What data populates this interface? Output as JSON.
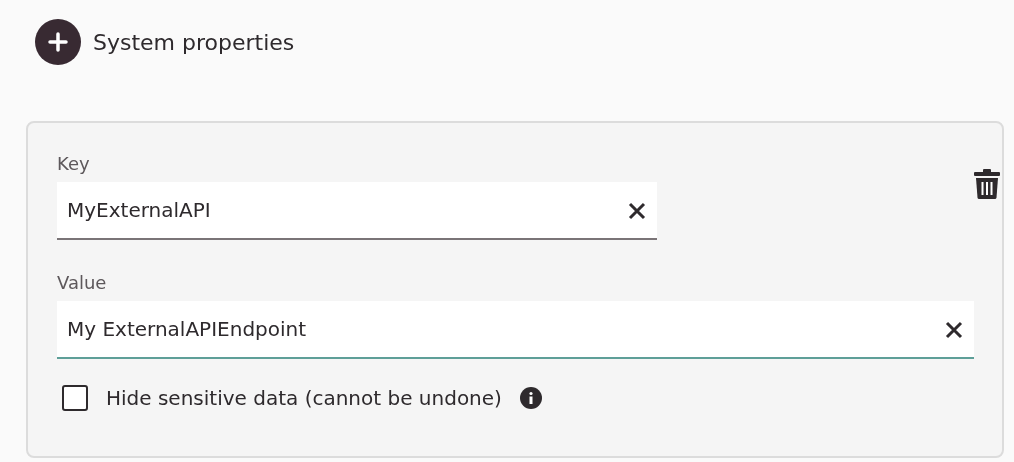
{
  "header": {
    "title": "System properties"
  },
  "property": {
    "fields": [
      {
        "label": "Key",
        "value": "MyExternalAPI",
        "focused": false
      },
      {
        "label": "Value",
        "value": "My ExternalAPIEndpoint",
        "focused": true
      }
    ],
    "hide_sensitive": {
      "label": "Hide sensitive data (cannot be undone)",
      "checked": false
    }
  }
}
